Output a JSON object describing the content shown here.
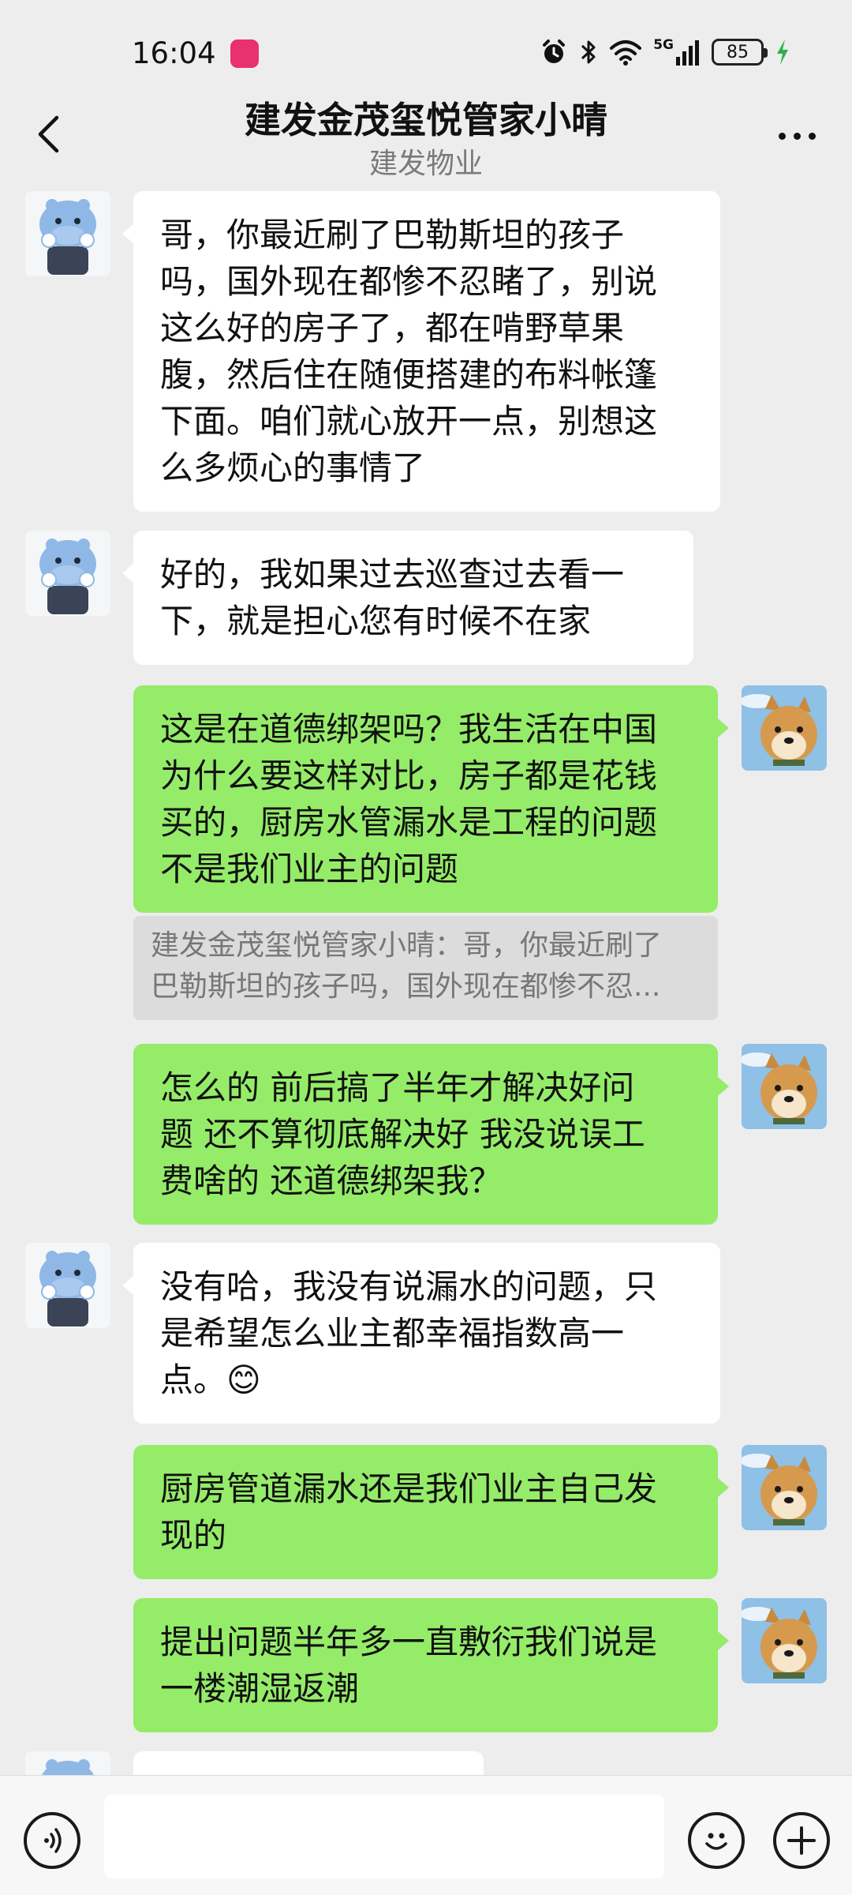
{
  "status_bar": {
    "time": "16:04",
    "network": "5G",
    "battery": "85",
    "app_icon_color": "#e8316f",
    "charging_color": "#2bb24c"
  },
  "header": {
    "title": "建发金茂玺悦管家小晴",
    "subtitle": "建发物业"
  },
  "colors": {
    "background": "#ededed",
    "incoming_bubble": "#ffffff",
    "outgoing_bubble": "#95ec69"
  },
  "messages": [
    {
      "side": "incoming",
      "lines": [
        "哥，你最近刷了巴勒斯坦的孩子",
        "吗，国外现在都惨不忍睹了，别说",
        "这么好的房子了，都在啃野草果",
        "腹，然后住在随便搭建的布料帐篷",
        "下面。咱们就心放开一点，别想这",
        "么多烦心的事情了"
      ]
    },
    {
      "side": "incoming",
      "lines": [
        "好的，我如果过去巡查过去看一",
        "下，就是担心您有时候不在家"
      ]
    },
    {
      "side": "outgoing",
      "lines": [
        "这是在道德绑架吗？我生活在中国",
        "为什么要这样对比，房子都是花钱",
        "买的，厨房水管漏水是工程的问题",
        "不是我们业主的问题"
      ]
    },
    {
      "side": "outgoing",
      "lines": [
        "怎么的  前后搞了半年才解决好问",
        "题 还不算彻底解决好  我没说误工",
        "费啥的  还道德绑架我？"
      ]
    },
    {
      "side": "incoming",
      "lines": [
        " 没有哈，我没有说漏水的问题，只",
        "是希望怎么业主都幸福指数高一",
        "点。😊"
      ]
    },
    {
      "side": "outgoing",
      "lines": [
        "厨房管道漏水还是我们业主自己发",
        "现的"
      ]
    },
    {
      "side": "outgoing",
      "lines": [
        "提出问题半年多一直敷衍我们说是",
        "一楼潮湿返潮"
      ]
    }
  ],
  "quote": {
    "lines": [
      "建发金茂玺悦管家小晴：哥，你最近刷了",
      "巴勒斯坦的孩子吗，国外现在都惨不忍..."
    ]
  },
  "input_bar": {
    "placeholder": "",
    "voice_icon": "voice-icon",
    "emoji_icon": "emoji-icon",
    "plus_icon": "plus-icon"
  }
}
